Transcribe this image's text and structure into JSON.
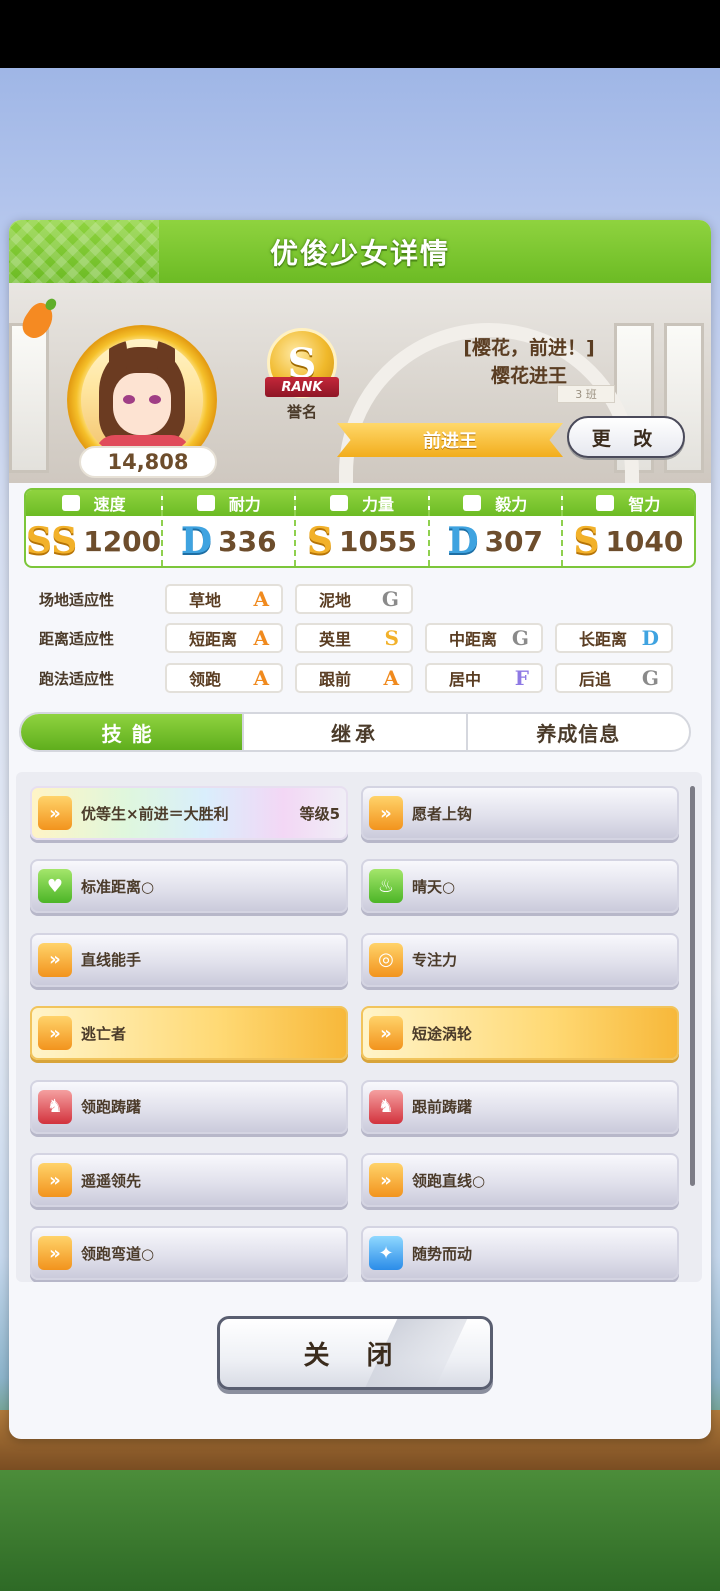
{
  "panel": {
    "title": "优俊少女详情"
  },
  "profile": {
    "fans": "14,808",
    "rank_letter": "S",
    "rank_ribbon": "RANK",
    "rank_label": "誉名",
    "title_line1": "[樱花，前进！]",
    "title_line2": "樱花进王",
    "class_tag": "3 班",
    "title_plate": "前进王",
    "change_button": "更 改"
  },
  "stats": [
    {
      "label": "速度",
      "grade": "SS",
      "value": "1200",
      "icon": "shoe-icon"
    },
    {
      "label": "耐力",
      "grade": "D",
      "value": "336",
      "icon": "heart-icon"
    },
    {
      "label": "力量",
      "grade": "S",
      "value": "1055",
      "icon": "muscle-icon"
    },
    {
      "label": "毅力",
      "grade": "D",
      "value": "307",
      "icon": "flame-icon"
    },
    {
      "label": "智力",
      "grade": "S",
      "value": "1040",
      "icon": "graduation-cap-icon"
    }
  ],
  "aptitude": {
    "field": {
      "label": "场地适应性",
      "items": [
        {
          "name": "草地",
          "grade": "A"
        },
        {
          "name": "泥地",
          "grade": "G"
        }
      ]
    },
    "distance": {
      "label": "距离适应性",
      "items": [
        {
          "name": "短距离",
          "grade": "A"
        },
        {
          "name": "英里",
          "grade": "S"
        },
        {
          "name": "中距离",
          "grade": "G"
        },
        {
          "name": "长距离",
          "grade": "D"
        }
      ]
    },
    "style": {
      "label": "跑法适应性",
      "items": [
        {
          "name": "领跑",
          "grade": "A"
        },
        {
          "name": "跟前",
          "grade": "A"
        },
        {
          "name": "居中",
          "grade": "F"
        },
        {
          "name": "后追",
          "grade": "G"
        }
      ]
    }
  },
  "tabs": [
    {
      "label": "技能"
    },
    {
      "label": "继承"
    },
    {
      "label": "养成信息"
    }
  ],
  "skills": [
    {
      "name": "优等生×前进＝大胜利",
      "level": "等级5",
      "icon": "speed-icon",
      "style": "rainbow"
    },
    {
      "name": "愿者上钩",
      "level": "",
      "icon": "speed-icon",
      "style": "normal"
    },
    {
      "name": "标准距离○",
      "level": "",
      "icon": "heart-icon",
      "style": "normal"
    },
    {
      "name": "晴天○",
      "level": "",
      "icon": "fire-icon",
      "style": "normal"
    },
    {
      "name": "直线能手",
      "level": "",
      "icon": "speed-icon",
      "style": "normal"
    },
    {
      "name": "专注力",
      "level": "",
      "icon": "focus-icon",
      "style": "normal"
    },
    {
      "name": "逃亡者",
      "level": "",
      "icon": "speed-icon",
      "style": "gold"
    },
    {
      "name": "短途涡轮",
      "level": "",
      "icon": "speed-icon",
      "style": "gold"
    },
    {
      "name": "领跑踌躇",
      "level": "",
      "icon": "debuff-icon",
      "style": "normal"
    },
    {
      "name": "跟前踌躇",
      "level": "",
      "icon": "debuff-icon",
      "style": "normal"
    },
    {
      "name": "遥遥领先",
      "level": "",
      "icon": "speed-icon",
      "style": "normal"
    },
    {
      "name": "领跑直线○",
      "level": "",
      "icon": "speed-icon",
      "style": "normal"
    },
    {
      "name": "领跑弯道○",
      "level": "",
      "icon": "speed-icon",
      "style": "normal"
    },
    {
      "name": "随势而动",
      "level": "",
      "icon": "sparkle-icon",
      "style": "normal"
    }
  ],
  "close_button": "关 闭"
}
